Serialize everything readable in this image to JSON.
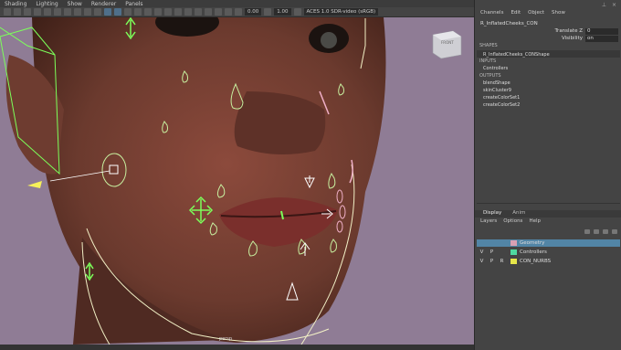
{
  "menu": [
    "Shading",
    "Lighting",
    "Show",
    "Renderer",
    "Panels"
  ],
  "toolbar": {
    "field1": "0.00",
    "field2": "1.00",
    "colorspace": "ACES 1.0 SDR-video (sRGB)"
  },
  "viewport": {
    "camera": "persp",
    "viewcube": "FRONT"
  },
  "panel": {
    "menu": [
      "Channels",
      "Edit",
      "Object",
      "Show"
    ],
    "node_name": "R_InflatedCheeks_CON",
    "attrs": [
      {
        "name": "Translate Z",
        "value": "0"
      },
      {
        "name": "Visibility",
        "value": "on"
      }
    ],
    "shapes_header": "SHAPES",
    "shape_item": "R_InflatedCheeks_CONShape",
    "inputs_header": "INPUTS",
    "inputs": [
      "Controllers"
    ],
    "outputs_header": "OUTPUTS",
    "outputs": [
      "blendShape",
      "skinCluster9",
      "createColorSet1",
      "createColorSet2"
    ]
  },
  "layer_editor": {
    "tabs": [
      "Display",
      "Anim"
    ],
    "menu": [
      "Layers",
      "Options",
      "Help"
    ],
    "layers": [
      {
        "v": "",
        "p": "",
        "r": "",
        "name": "Geometry",
        "color": "#d9a0b4",
        "selected": true
      },
      {
        "v": "V",
        "p": "P",
        "r": "",
        "name": "Controllers",
        "color": "#4fd9a0",
        "selected": false
      },
      {
        "v": "V",
        "p": "P",
        "r": "R",
        "name": "CON_NURBS",
        "color": "#e6e64a",
        "selected": false
      }
    ]
  }
}
